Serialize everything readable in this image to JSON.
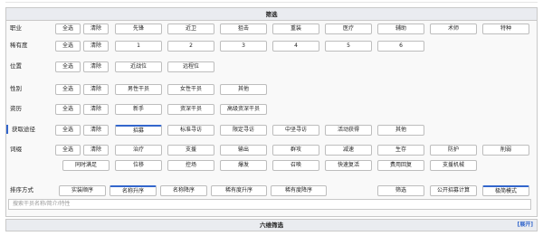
{
  "panel": {
    "title": "筛选"
  },
  "filters": [
    {
      "label": "职业",
      "options": [
        "先锋",
        "近卫",
        "狙击",
        "重装",
        "医疗",
        "辅助",
        "术师",
        "特种"
      ]
    },
    {
      "label": "稀有度",
      "options": [
        "1",
        "2",
        "3",
        "4",
        "5",
        "6"
      ]
    },
    {
      "label": "位置",
      "options": [
        "近战位",
        "远程位"
      ]
    },
    {
      "label": "性别",
      "options": [
        "男性干员",
        "女性干员",
        "其他"
      ]
    },
    {
      "label": "资历",
      "options": [
        "新手",
        "资深干员",
        "高级资深干员"
      ]
    },
    {
      "label": "获取途径",
      "options": [
        "招募",
        "标准寻访",
        "限定寻访",
        "中坚寻访",
        "活动获得",
        "其他"
      ]
    },
    {
      "label": "词缀",
      "options": [
        "治疗",
        "支援",
        "输出",
        "群攻",
        "减速",
        "生存",
        "防护",
        "削弱",
        "同时满足",
        "位移",
        "控场",
        "爆发",
        "召唤",
        "快速复活",
        "费用回复",
        "支援机械"
      ]
    }
  ],
  "common": {
    "select_all": "全选",
    "clear": "清除"
  },
  "sort": {
    "label": "排序方式",
    "options": [
      "实装顺序",
      "名称升序",
      "名称降序",
      "稀有度升序",
      "稀有度降序"
    ],
    "actions": [
      "筛选",
      "公开招募计算",
      "极简模式"
    ]
  },
  "search": {
    "placeholder": "搜索干员名称/简介/特性"
  },
  "footer": {
    "title": "六维筛选",
    "expand": "[展开]"
  },
  "colors": {
    "accent": "#3366cc",
    "header_bg": "#eaecf0",
    "border": "#c8c8c8"
  }
}
